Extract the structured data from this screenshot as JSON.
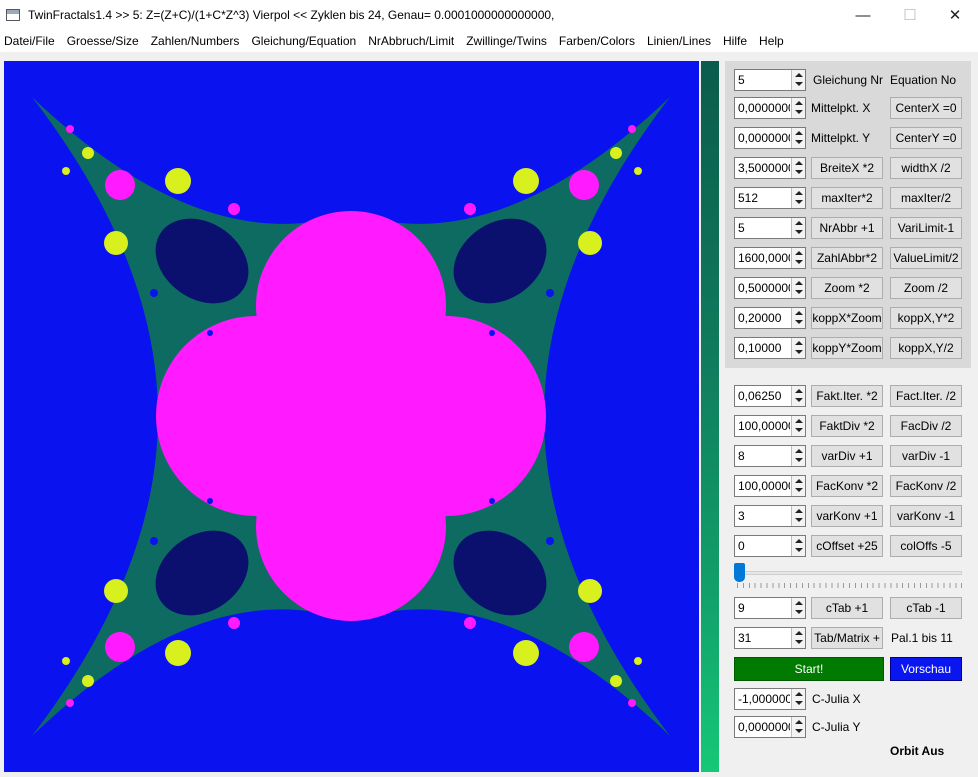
{
  "window": {
    "title": "TwinFractals1.4 >> 5: Z=(Z+C)/(1+C*Z^3) Vierpol << Zyklen bis 24, Genau= 0.0001000000000000,",
    "minimize": "—",
    "maximize": "☐",
    "close": "✕"
  },
  "menu": [
    "Datei/File",
    "Groesse/Size",
    "Zahlen/Numbers",
    "Gleichung/Equation",
    "NrAbbruch/Limit",
    "Zwillinge/Twins",
    "Farben/Colors",
    "Linien/Lines",
    "Hilfe",
    "Help"
  ],
  "colors": {
    "background": "#0a12f0",
    "teal": "#0d6b62",
    "pink": "#ff1aff",
    "navy": "#0b0f6e",
    "yellow": "#d8f01e",
    "start": "#007a00",
    "preview": "#0a16f0"
  },
  "panel_top": {
    "equation": {
      "value": "5",
      "label_de": "Gleichung Nr",
      "label_en": "Equation No"
    },
    "center_x": {
      "value": "0,0000000",
      "label": "Mittelpkt. X",
      "button": "CenterX =0"
    },
    "center_y": {
      "value": "0,0000000",
      "label": "Mittelpkt. Y",
      "button": "CenterY =0"
    },
    "width_x": {
      "value": "3,5000000",
      "btn1": "BreiteX *2",
      "btn2": "widthX /2"
    },
    "max_iter": {
      "value": "512",
      "btn1": "maxIter*2",
      "btn2": "maxIter/2"
    },
    "nr_abbr": {
      "value": "5",
      "btn1": "NrAbbr +1",
      "btn2": "VariLimit-1"
    },
    "zahl_abbr": {
      "value": "1600,0000",
      "btn1": "ZahlAbbr*2",
      "btn2": "ValueLimit/2"
    },
    "zoom": {
      "value": "0,5000000",
      "btn1": "Zoom *2",
      "btn2": "Zoom /2"
    },
    "kopp_x": {
      "value": "0,20000",
      "btn1": "koppX*Zoom",
      "btn2": "koppX,Y*2"
    },
    "kopp_y": {
      "value": "0,10000",
      "btn1": "koppY*Zoom",
      "btn2": "koppX,Y/2"
    }
  },
  "panel_bottom": {
    "fakt_iter": {
      "value": "0,06250",
      "btn1": "Fakt.Iter. *2",
      "btn2": "Fact.Iter. /2"
    },
    "fakt_div": {
      "value": "100,00000",
      "btn1": "FaktDiv *2",
      "btn2": "FacDiv /2"
    },
    "var_div": {
      "value": "8",
      "btn1": "varDiv +1",
      "btn2": "varDiv -1"
    },
    "fac_konv": {
      "value": "100,00000",
      "btn1": "FacKonv *2",
      "btn2": "FacKonv /2"
    },
    "var_konv": {
      "value": "3",
      "btn1": "varKonv +1",
      "btn2": "varKonv -1"
    },
    "c_offset": {
      "value": "0",
      "btn1": "cOffset +25",
      "btn2": "colOffs -5"
    },
    "slider_value": 0,
    "c_tab": {
      "value": "9",
      "btn1": "cTab +1",
      "btn2": "cTab -1"
    },
    "tab_matrix": {
      "value": "31",
      "btn1": "Tab/Matrix +",
      "label": "Pal.1 bis 11"
    },
    "start": "Start!",
    "preview": "Vorschau",
    "c_julia_x": {
      "value": "-1,000000",
      "label": "C-Julia X"
    },
    "c_julia_y": {
      "value": "0,0000000",
      "label": "C-Julia Y"
    },
    "orbit": "Orbit Aus"
  }
}
